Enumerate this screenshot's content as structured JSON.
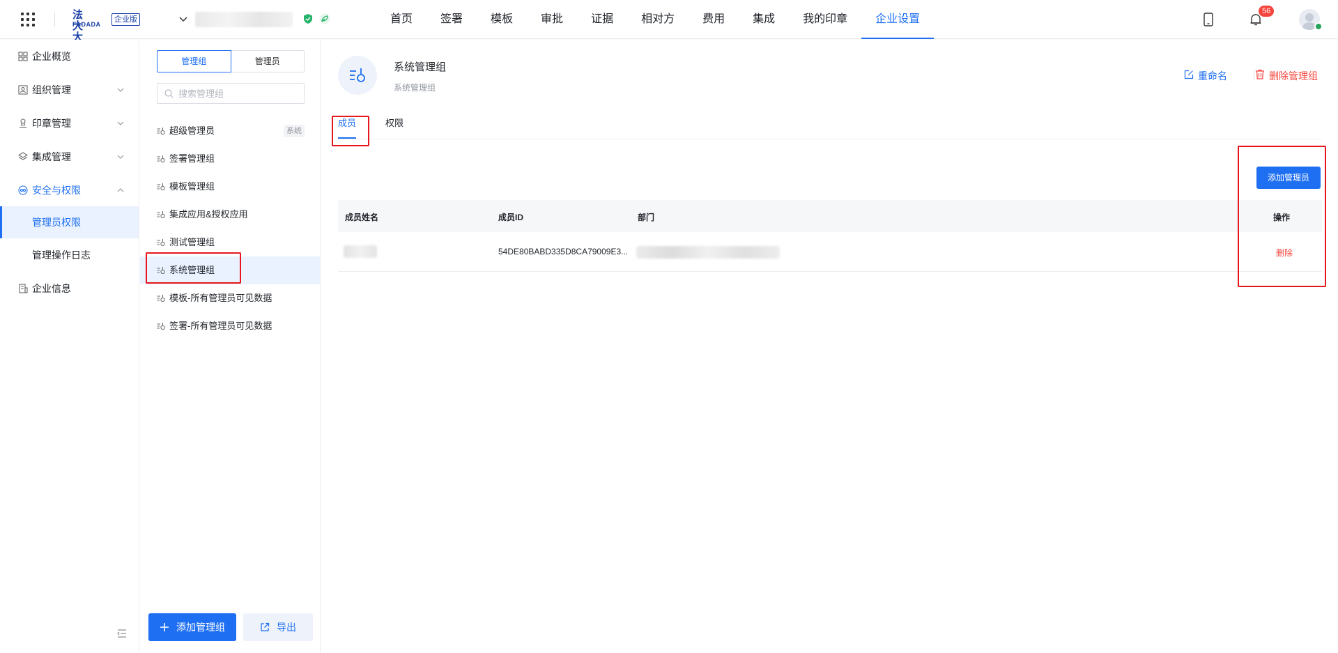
{
  "topbar": {
    "logo_cn": "法大大",
    "logo_en": "FADADA",
    "edition": "企业版",
    "nav": [
      "首页",
      "签署",
      "模板",
      "审批",
      "证据",
      "相对方",
      "费用",
      "集成",
      "我的印章",
      "企业设置"
    ],
    "active_nav_index": 9,
    "notification_count": "56"
  },
  "sidebar": {
    "items": [
      {
        "label": "企业概览",
        "icon": "overview-icon"
      },
      {
        "label": "组织管理",
        "icon": "org-icon",
        "expandable": true
      },
      {
        "label": "印章管理",
        "icon": "seal-icon",
        "expandable": true
      },
      {
        "label": "集成管理",
        "icon": "layers-icon",
        "expandable": true
      },
      {
        "label": "安全与权限",
        "icon": "security-icon",
        "expanded": true
      },
      {
        "label": "管理员权限",
        "sub": true,
        "active": true
      },
      {
        "label": "管理操作日志",
        "sub": true
      },
      {
        "label": "企业信息",
        "icon": "info-icon"
      }
    ]
  },
  "groups": {
    "segment": {
      "groups_label": "管理组",
      "admins_label": "管理员"
    },
    "search_placeholder": "搜索管理组",
    "system_tag": "系统",
    "items": [
      "超级管理员",
      "签署管理组",
      "模板管理组",
      "集成应用&授权应用",
      "测试管理组",
      "系统管理组",
      "模板-所有管理员可见数据",
      "签署-所有管理员可见数据"
    ],
    "active_index": 5,
    "add_group_label": "添加管理组",
    "export_label": "导出"
  },
  "detail": {
    "title": "系统管理组",
    "subtitle": "系统管理组",
    "rename_label": "重命名",
    "delete_label": "删除管理组",
    "tabs": [
      "成员",
      "权限"
    ],
    "active_tab": 0,
    "add_admin_label": "添加管理员",
    "table": {
      "columns": [
        "成员姓名",
        "成员ID",
        "部门",
        "操作"
      ],
      "rows": [
        {
          "member_id": "54DE80BABD335D8CA79009E3...",
          "action": "删除"
        }
      ]
    }
  },
  "colors": {
    "accent": "#1e6ff1",
    "danger": "#f5453d",
    "highlight": "#e5161e"
  }
}
